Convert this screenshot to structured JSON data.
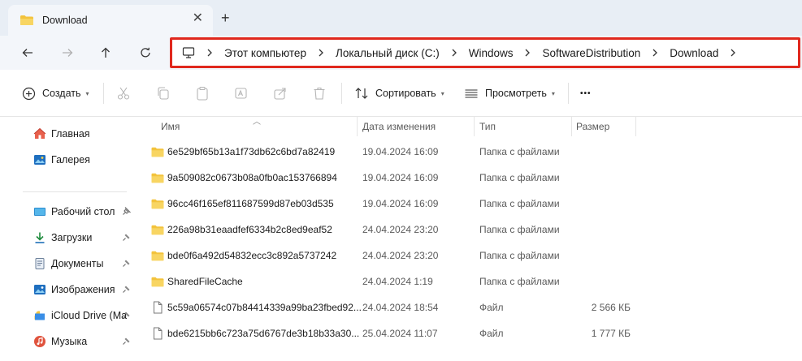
{
  "window": {
    "tab_title": "Download",
    "close_glyph": "✕",
    "add_glyph": "+"
  },
  "colors": {
    "folder": "#f3c33c",
    "highlight_border": "#e0281d",
    "accent": "#0067c0"
  },
  "address_bar": {
    "root_icon": "monitor-icon",
    "crumbs": [
      "Этот компьютер",
      "Локальный диск (C:)",
      "Windows",
      "SoftwareDistribution",
      "Download"
    ]
  },
  "command_bar": {
    "new_label": "Создать",
    "sort_label": "Сортировать",
    "view_label": "Просмотреть",
    "more_glyph": "•••"
  },
  "sidebar": {
    "items": [
      {
        "label": "Главная",
        "icon": "home-icon"
      },
      {
        "label": "Галерея",
        "icon": "gallery-icon"
      },
      {
        "label": "Рабочий стол",
        "icon": "desktop-icon",
        "pinned": true
      },
      {
        "label": "Загрузки",
        "icon": "download-icon",
        "pinned": true
      },
      {
        "label": "Документы",
        "icon": "documents-icon",
        "pinned": true
      },
      {
        "label": "Изображения",
        "icon": "pictures-icon",
        "pinned": true
      },
      {
        "label": "iCloud Drive (Ma",
        "icon": "icloud-icon",
        "pinned": true
      },
      {
        "label": "Музыка",
        "icon": "music-icon",
        "pinned": true
      }
    ]
  },
  "file_list": {
    "columns": [
      "Имя",
      "Дата изменения",
      "Тип",
      "Размер"
    ],
    "rows": [
      {
        "name": "6e529bf65b13a1f73db62c6bd7a82419",
        "date": "19.04.2024 16:09",
        "type": "Папка с файлами",
        "size": "",
        "kind": "folder"
      },
      {
        "name": "9a509082c0673b08a0fb0ac153766894",
        "date": "19.04.2024 16:09",
        "type": "Папка с файлами",
        "size": "",
        "kind": "folder"
      },
      {
        "name": "96cc46f165ef811687599d87eb03d535",
        "date": "19.04.2024 16:09",
        "type": "Папка с файлами",
        "size": "",
        "kind": "folder"
      },
      {
        "name": "226a98b31eaadfef6334b2c8ed9eaf52",
        "date": "24.04.2024 23:20",
        "type": "Папка с файлами",
        "size": "",
        "kind": "folder"
      },
      {
        "name": "bde0f6a492d54832ecc3c892a5737242",
        "date": "24.04.2024 23:20",
        "type": "Папка с файлами",
        "size": "",
        "kind": "folder"
      },
      {
        "name": "SharedFileCache",
        "date": "24.04.2024 1:19",
        "type": "Папка с файлами",
        "size": "",
        "kind": "folder"
      },
      {
        "name": "5c59a06574c07b84414339a99ba23fbed92...",
        "date": "24.04.2024 18:54",
        "type": "Файл",
        "size": "2 566 КБ",
        "kind": "file"
      },
      {
        "name": "bde6215bb6c723a75d6767de3b18b33a30...",
        "date": "25.04.2024 11:07",
        "type": "Файл",
        "size": "1 777 КБ",
        "kind": "file"
      }
    ]
  }
}
